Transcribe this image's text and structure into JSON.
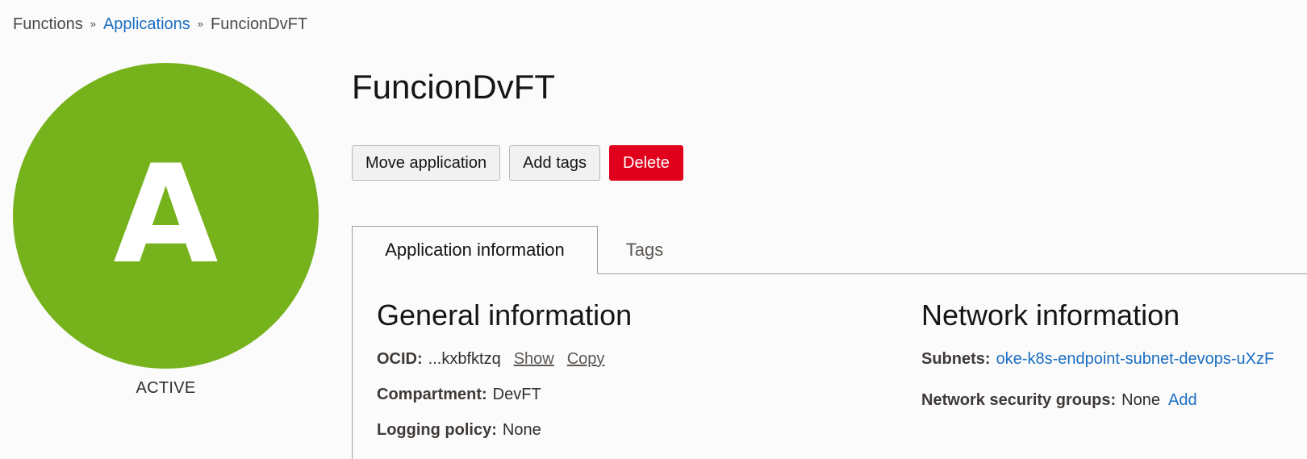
{
  "breadcrumb": {
    "items": [
      "Functions",
      "Applications",
      "FuncionDvFT"
    ],
    "separator": "»"
  },
  "avatar": {
    "letter": "A",
    "status": "ACTIVE",
    "color": "#76b21c"
  },
  "page": {
    "title": "FuncionDvFT"
  },
  "actions": {
    "move": "Move application",
    "add_tags": "Add tags",
    "delete": "Delete"
  },
  "tabs": [
    {
      "label": "Application information",
      "active": true
    },
    {
      "label": "Tags",
      "active": false
    }
  ],
  "general": {
    "heading": "General information",
    "ocid_label": "OCID:",
    "ocid_value": "...kxbfktzq",
    "show": "Show",
    "copy": "Copy",
    "compartment_label": "Compartment:",
    "compartment_value": "DevFT",
    "logging_label": "Logging policy:",
    "logging_value": "None"
  },
  "network": {
    "heading": "Network information",
    "subnets_label": "Subnets:",
    "subnets_value": "oke-k8s-endpoint-subnet-devops-uXzF",
    "nsg_label": "Network security groups:",
    "nsg_value": "None",
    "nsg_add": "Add"
  },
  "colors": {
    "link": "#1b6ec2",
    "danger": "#e0001b",
    "active_status": "#76b21c"
  }
}
